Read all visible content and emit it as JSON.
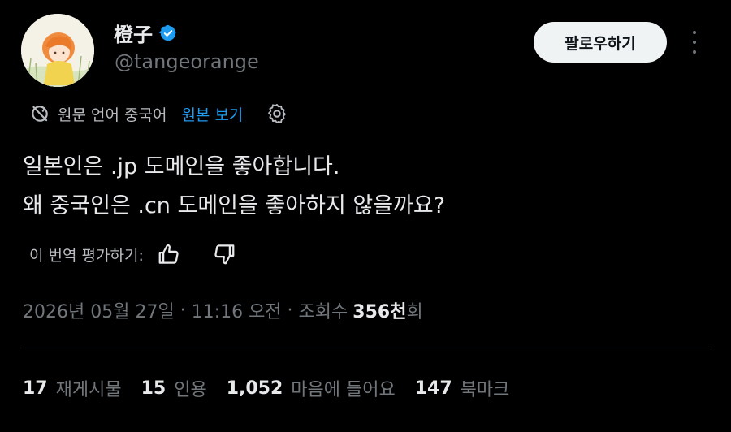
{
  "author": {
    "display_name": "橙子",
    "handle": "@tangeorange",
    "verified": true,
    "verified_color": "#1d9bf0"
  },
  "actions": {
    "follow_label": "팔로우하기"
  },
  "translation": {
    "source_language": "원문 언어 중국어",
    "show_original": "원본 보기"
  },
  "tweet": {
    "lines": [
      "일본인은 .jp 도메인을 좋아합니다.",
      "왜 중국인은 .cn 도메인을 좋아하지 않을까요?"
    ]
  },
  "rating": {
    "label": "이 번역 평가하기:"
  },
  "meta": {
    "date": "2026년 05월 27일",
    "time": "11:16 오전",
    "views_prefix": "조회수",
    "views_count": "356천",
    "views_suffix": "회"
  },
  "stats": [
    {
      "count": "17",
      "label": "재게시물"
    },
    {
      "count": "15",
      "label": "인용"
    },
    {
      "count": "1,052",
      "label": "마음에 들어요"
    },
    {
      "count": "147",
      "label": "북마크"
    }
  ]
}
